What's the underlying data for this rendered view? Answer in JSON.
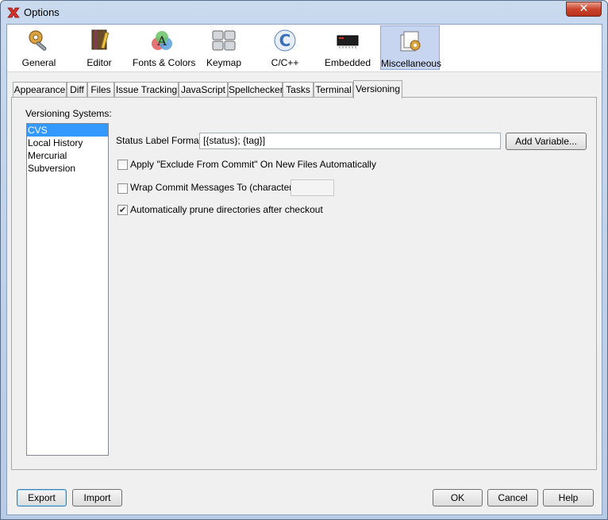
{
  "window": {
    "title": "Options",
    "app_icon": "netbeans-x-icon",
    "close_glyph": "✕"
  },
  "toolbar": {
    "items": [
      {
        "label": "General",
        "icon": "gear-wrench-icon",
        "selected": false
      },
      {
        "label": "Editor",
        "icon": "notebook-pencil-icon",
        "selected": false
      },
      {
        "label": "Fonts & Colors",
        "icon": "font-palette-icon",
        "selected": false
      },
      {
        "label": "Keymap",
        "icon": "keyboard-keys-icon",
        "selected": false
      },
      {
        "label": "C/C++",
        "icon": "cpp-icon",
        "selected": false
      },
      {
        "label": "Embedded",
        "icon": "chip-icon",
        "selected": false
      },
      {
        "label": "Miscellaneous",
        "icon": "misc-gear-icon",
        "selected": true
      }
    ]
  },
  "tabs": [
    "Appearance",
    "Diff",
    "Files",
    "Issue Tracking",
    "JavaScript",
    "Spellchecker",
    "Tasks",
    "Terminal",
    "Versioning"
  ],
  "active_tab": "Versioning",
  "versioning": {
    "systems_label": "Versioning Systems:",
    "systems": [
      "CVS",
      "Local History",
      "Mercurial",
      "Subversion"
    ],
    "selected_system": "CVS",
    "status_label_format_label": "Status Label Format:",
    "status_label_format_value": "[{status}; {tag}]",
    "add_variable_label": "Add Variable...",
    "exclude_checkbox_label": "Apply \"Exclude From Commit\" On New Files Automatically",
    "exclude_checked": false,
    "wrap_checkbox_label": "Wrap Commit Messages To (characters):",
    "wrap_checked": false,
    "wrap_value": "",
    "prune_checkbox_label": "Automatically prune directories after checkout",
    "prune_checked": true
  },
  "footer": {
    "export_label": "Export",
    "import_label": "Import",
    "ok_label": "OK",
    "cancel_label": "Cancel",
    "help_label": "Help"
  },
  "colors": {
    "selection": "#3399ff",
    "toolbar_selected": "#c7d5f0",
    "close_button": "#c9442a"
  }
}
